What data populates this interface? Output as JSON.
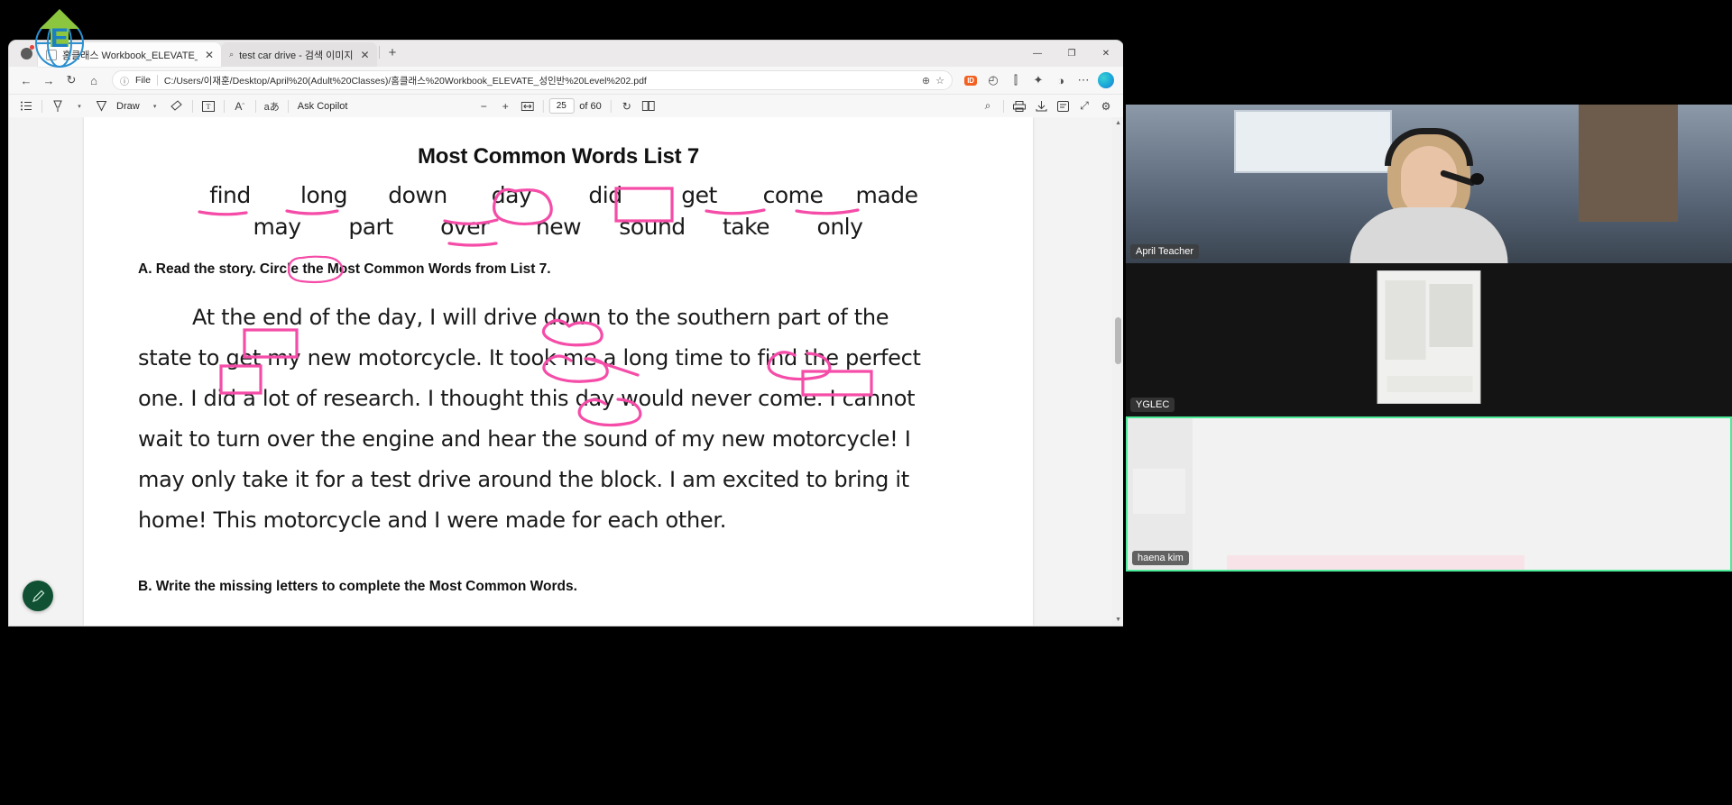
{
  "browser": {
    "tabs": [
      {
        "title": "홈클래스 Workbook_ELEVATE_성",
        "icon": "page-icon",
        "active": true,
        "close_label": "✕"
      },
      {
        "title": "test car drive - 검색 이미지",
        "icon": "search-icon",
        "active": false,
        "close_label": "✕"
      }
    ],
    "new_tab_label": "+",
    "nav": {
      "back_label": "←",
      "forward_label": "→",
      "refresh_label": "↻",
      "home_label": "⌂"
    },
    "omnibox": {
      "info_icon": "info-icon",
      "file_label": "File",
      "url": "C:/Users/이재훈/Desktop/April%20(Adult%20Classes)/홈클래스%20Workbook_ELEVATE_성인반%20Level%202.pdf",
      "zoom_icon": "zoom-magnifier-icon",
      "favorite_icon": "star-icon",
      "extension_badge": "ID",
      "history_icon": "history-icon",
      "split_icon": "split-screen-icon",
      "collections_icon": "collections-icon",
      "settings_icon": "more-icon",
      "copilot_icon": "copilot-icon"
    },
    "window_controls": {
      "minimize": "—",
      "maximize": "❐",
      "close": "✕"
    }
  },
  "pdf_toolbar": {
    "left_tools": [
      {
        "name": "table-of-contents-icon",
        "glyph": "☰"
      },
      {
        "name": "highlighter-icon",
        "glyph": "highlighter"
      },
      {
        "name": "highlighter-dropdown-icon",
        "glyph": "▾"
      },
      {
        "name": "draw-pen-icon",
        "glyph": "pen"
      },
      {
        "name": "draw-label",
        "glyph": "Draw"
      },
      {
        "name": "draw-dropdown-icon",
        "glyph": "▾"
      },
      {
        "name": "eraser-icon",
        "glyph": "eraser"
      },
      {
        "name": "text-box-icon",
        "glyph": "T"
      },
      {
        "name": "read-aloud-icon",
        "glyph": "A"
      },
      {
        "name": "translate-icon",
        "glyph": "aあ"
      },
      {
        "name": "ask-copilot-label",
        "glyph": "Ask Copilot"
      }
    ],
    "draw_label": "Draw",
    "ask_copilot_label": "Ask Copilot",
    "translate_label": "aあ",
    "zoom_out_label": "−",
    "zoom_in_label": "+",
    "fit_page_label": "fit-page-icon",
    "current_page": "25",
    "page_total_label": "of 60",
    "rotate_label": "↻",
    "page_view_label": "page-view-icon",
    "right_tools": [
      {
        "name": "search-in-document-icon",
        "glyph": "⌕"
      },
      {
        "name": "print-icon",
        "glyph": "print"
      },
      {
        "name": "save-icon",
        "glyph": "save"
      },
      {
        "name": "add-notes-icon",
        "glyph": "notes"
      },
      {
        "name": "fullscreen-icon",
        "glyph": "⤢"
      },
      {
        "name": "settings-icon",
        "glyph": "⚙"
      }
    ]
  },
  "document": {
    "title": "Most Common Words List 7",
    "word_rows": [
      [
        "find",
        "long",
        "down",
        "day",
        "did",
        "get",
        "come",
        "made"
      ],
      [
        "may",
        "part",
        "over",
        "new",
        "sound",
        "take",
        "only",
        ""
      ]
    ],
    "section_a": "A. Read the story. Circle the Most Common Words from List 7.",
    "story_lines": [
      "At the end of the day, I will drive down to the southern part of the",
      "state to get my new motorcycle. It took me a long time to find the perfect",
      "one. I did a lot of research. I thought this day would never come. I cannot",
      "wait to turn over the engine and hear the sound of my new motorcycle! I",
      "may only take it for a test drive around the block. I am excited to bring it",
      "home! This motorcycle and I were made for each other."
    ],
    "section_b": "B. Write the missing letters to complete the Most Common Words.",
    "ink_color": "#f54ca8",
    "annotated_words": [
      "find",
      "long",
      "down",
      "day",
      "did",
      "get",
      "come",
      "made"
    ]
  },
  "video_panel": {
    "participants": [
      {
        "name": "April Teacher",
        "type": "webcam",
        "active_speaker": false
      },
      {
        "name": "YGLEC",
        "type": "screen-share",
        "active_speaker": false
      },
      {
        "name": "haena kim",
        "type": "whiteboard",
        "active_speaker": true
      }
    ],
    "active_border_color": "#4ceb9a"
  },
  "overlay": {
    "logo_text": "E",
    "edit_fab_icon": "pencil-icon"
  }
}
